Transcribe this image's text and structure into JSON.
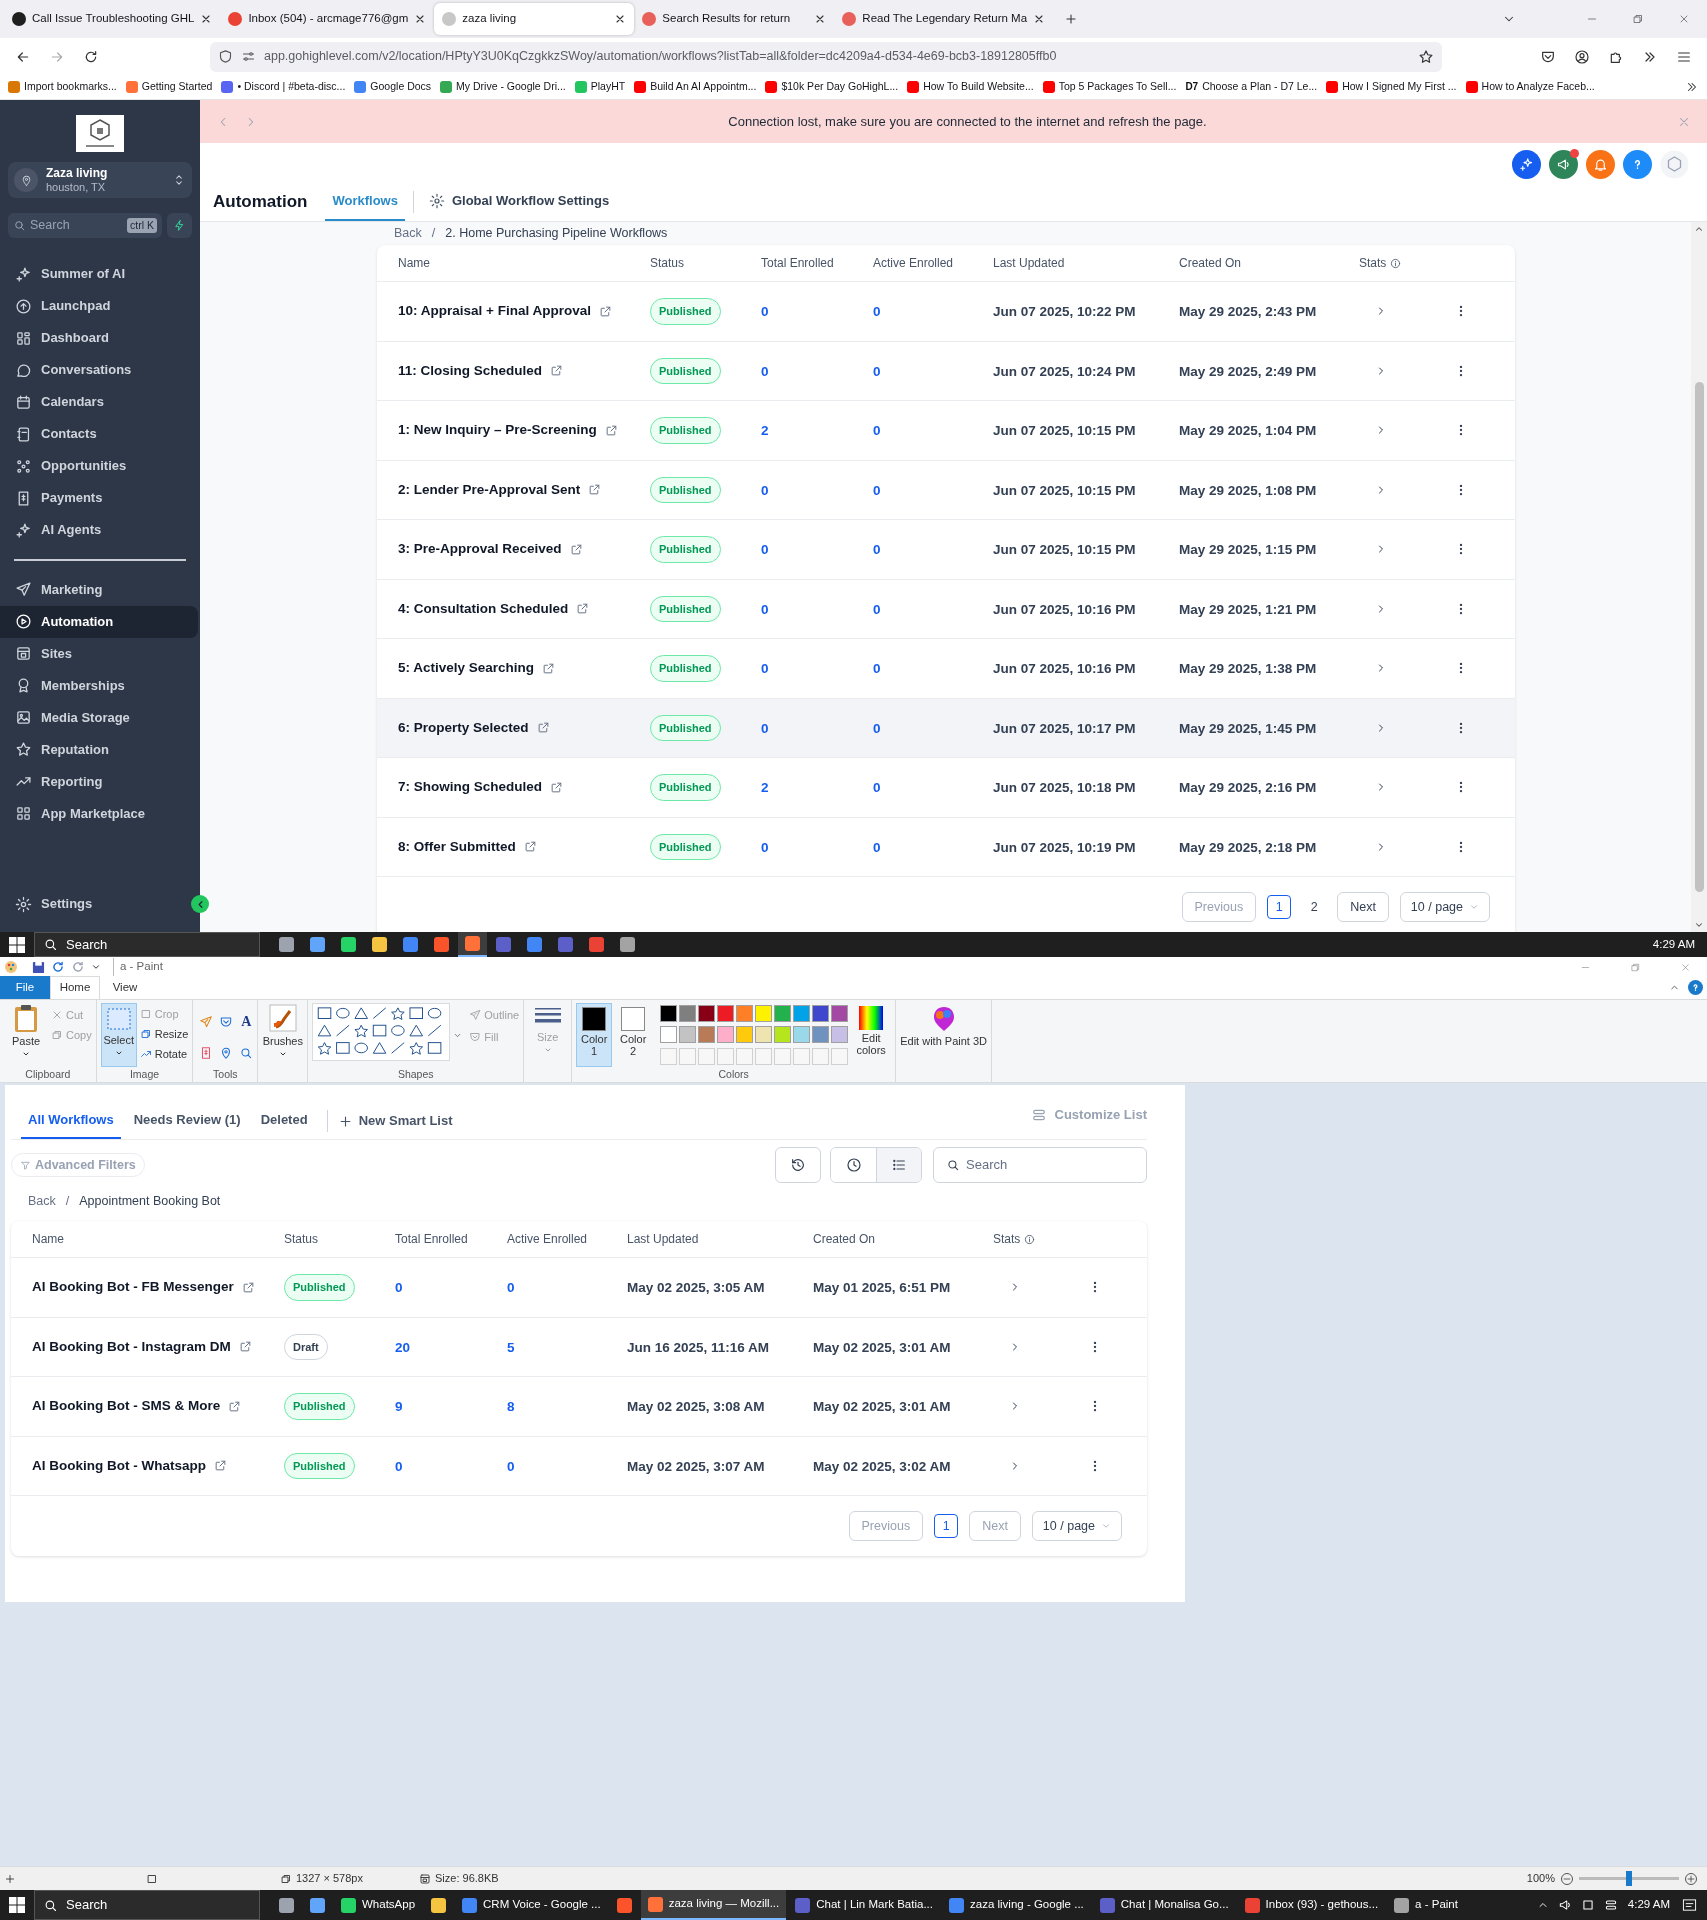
{
  "browser": {
    "tabs": [
      {
        "title": "Call Issue Troubleshooting GHL",
        "color": "#1f1f1f",
        "selected": false
      },
      {
        "title": "Inbox (504) - arcmage776@gm",
        "color": "#ea4335",
        "selected": false
      },
      {
        "title": "zaza living",
        "color": "#c8c8c8",
        "selected": true
      },
      {
        "title": "Search Results for return",
        "color": "#e8605a",
        "selected": false
      },
      {
        "title": "Read The Legendary Return Ma",
        "color": "#e8605a",
        "selected": false
      }
    ],
    "url": "app.gohighlevel.com/v2/location/HPtyY3U0KqCzgkkzSWoy/automation/workflows?listTab=all&folder=dc4209a4-d534-4e69-bcb3-18912805ffb0",
    "bookmarks": [
      {
        "label": "Import bookmarks...",
        "color": "#d97706"
      },
      {
        "label": "Getting Started",
        "color": "#ff7139"
      },
      {
        "label": "• Discord | #beta-disc...",
        "color": "#5865f2"
      },
      {
        "label": "Google Docs",
        "color": "#4285f4"
      },
      {
        "label": "My Drive - Google Dri...",
        "color": "#34a853"
      },
      {
        "label": "PlayHT",
        "color": "#22c55e"
      },
      {
        "label": "Build An AI Appointm...",
        "color": "#ff0000"
      },
      {
        "label": "$10k Per Day GoHighL...",
        "color": "#ff0000"
      },
      {
        "label": "How To Build Website...",
        "color": "#ff0000"
      },
      {
        "label": "Top 5 Packages To Sell...",
        "color": "#ff0000"
      },
      {
        "label": "Choose a Plan - D7 Le...",
        "color": "#111111",
        "icon_text": "D7"
      },
      {
        "label": "How I Signed My First ...",
        "color": "#ff0000"
      },
      {
        "label": "How to Analyze Faceb...",
        "color": "#ff0000"
      }
    ]
  },
  "app": {
    "banner": {
      "text": "Connection lost, make sure you are connected to the internet and refresh the page."
    },
    "sidebar": {
      "account": {
        "name": "Zaza living",
        "location": "houston, TX"
      },
      "search": {
        "placeholder": "Search",
        "shortcut": "ctrl K"
      },
      "items": [
        {
          "label": "Summer of AI",
          "selected": false
        },
        {
          "label": "Launchpad",
          "selected": false
        },
        {
          "label": "Dashboard",
          "selected": false
        },
        {
          "label": "Conversations",
          "selected": false
        },
        {
          "label": "Calendars",
          "selected": false
        },
        {
          "label": "Contacts",
          "selected": false
        },
        {
          "label": "Opportunities",
          "selected": false
        },
        {
          "label": "Payments",
          "selected": false
        },
        {
          "label": "AI Agents",
          "selected": false
        }
      ],
      "items_secondary": [
        {
          "label": "Marketing",
          "selected": false
        },
        {
          "label": "Automation",
          "selected": true
        },
        {
          "label": "Sites",
          "selected": false
        },
        {
          "label": "Memberships",
          "selected": false
        },
        {
          "label": "Media Storage",
          "selected": false
        },
        {
          "label": "Reputation",
          "selected": false
        },
        {
          "label": "Reporting",
          "selected": false
        },
        {
          "label": "App Marketplace",
          "selected": false
        }
      ],
      "settings": {
        "label": "Settings",
        "selected": false
      }
    },
    "header": {
      "title": "Automation",
      "tabs": [
        {
          "label": "Workflows",
          "selected": true
        },
        {
          "label": "Global Workflow Settings",
          "selected": false
        }
      ],
      "notification_dot": true
    },
    "breadcrumb": {
      "back": "Back",
      "separator": "/",
      "current": "2. Home Purchasing Pipeline Workflows"
    },
    "table": {
      "columns": [
        "Name",
        "Status",
        "Total Enrolled",
        "Active Enrolled",
        "Last Updated",
        "Created On",
        "Stats"
      ],
      "rows": [
        {
          "name": "10: Appraisal + Final Approval",
          "status": {
            "label": "Published",
            "kind": "published"
          },
          "total_enrolled": "0",
          "active_enrolled": "0",
          "last_updated": "Jun 07 2025, 10:22 PM",
          "created_on": "May 29 2025, 2:43 PM",
          "hovered": false
        },
        {
          "name": "11: Closing Scheduled",
          "status": {
            "label": "Published",
            "kind": "published"
          },
          "total_enrolled": "0",
          "active_enrolled": "0",
          "last_updated": "Jun 07 2025, 10:24 PM",
          "created_on": "May 29 2025, 2:49 PM",
          "hovered": false
        },
        {
          "name": "1: New Inquiry – Pre-Screening",
          "status": {
            "label": "Published",
            "kind": "published"
          },
          "total_enrolled": "2",
          "active_enrolled": "0",
          "last_updated": "Jun 07 2025, 10:15 PM",
          "created_on": "May 29 2025, 1:04 PM",
          "hovered": false
        },
        {
          "name": "2: Lender Pre-Approval Sent",
          "status": {
            "label": "Published",
            "kind": "published"
          },
          "total_enrolled": "0",
          "active_enrolled": "0",
          "last_updated": "Jun 07 2025, 10:15 PM",
          "created_on": "May 29 2025, 1:08 PM",
          "hovered": false
        },
        {
          "name": "3: Pre-Approval Received",
          "status": {
            "label": "Published",
            "kind": "published"
          },
          "total_enrolled": "0",
          "active_enrolled": "0",
          "last_updated": "Jun 07 2025, 10:15 PM",
          "created_on": "May 29 2025, 1:15 PM",
          "hovered": false
        },
        {
          "name": "4: Consultation Scheduled",
          "status": {
            "label": "Published",
            "kind": "published"
          },
          "total_enrolled": "0",
          "active_enrolled": "0",
          "last_updated": "Jun 07 2025, 10:16 PM",
          "created_on": "May 29 2025, 1:21 PM",
          "hovered": false
        },
        {
          "name": "5: Actively Searching",
          "status": {
            "label": "Published",
            "kind": "published"
          },
          "total_enrolled": "0",
          "active_enrolled": "0",
          "last_updated": "Jun 07 2025, 10:16 PM",
          "created_on": "May 29 2025, 1:38 PM",
          "hovered": false
        },
        {
          "name": "6: Property Selected",
          "status": {
            "label": "Published",
            "kind": "published"
          },
          "total_enrolled": "0",
          "active_enrolled": "0",
          "last_updated": "Jun 07 2025, 10:17 PM",
          "created_on": "May 29 2025, 1:45 PM",
          "hovered": true
        },
        {
          "name": "7: Showing Scheduled",
          "status": {
            "label": "Published",
            "kind": "published"
          },
          "total_enrolled": "2",
          "active_enrolled": "0",
          "last_updated": "Jun 07 2025, 10:18 PM",
          "created_on": "May 29 2025, 2:16 PM",
          "hovered": false
        },
        {
          "name": "8: Offer Submitted",
          "status": {
            "label": "Published",
            "kind": "published"
          },
          "total_enrolled": "0",
          "active_enrolled": "0",
          "last_updated": "Jun 07 2025, 10:19 PM",
          "created_on": "May 29 2025, 2:18 PM",
          "hovered": false
        }
      ]
    },
    "pagination": {
      "previous": {
        "label": "Previous",
        "disabled": true
      },
      "pages": [
        {
          "label": "1",
          "selected": true
        },
        {
          "label": "2",
          "selected": false
        }
      ],
      "next": {
        "label": "Next",
        "disabled": false
      },
      "page_size": "10 / page"
    }
  },
  "taskbar_top": {
    "search_placeholder": "Search",
    "time": "4:29 AM",
    "apps": [
      {
        "color": "#9ca3af",
        "selected": false
      },
      {
        "color": "#60a5fa",
        "selected": false
      },
      {
        "color": "#25d366",
        "selected": false
      },
      {
        "color": "#f5c542",
        "selected": false
      },
      {
        "color": "#4285f4",
        "selected": false
      },
      {
        "color": "#fb542b",
        "selected": false
      },
      {
        "color": "#ff7139",
        "selected": true
      },
      {
        "color": "#5b5fc7",
        "selected": false
      },
      {
        "color": "#4285f4",
        "selected": false
      },
      {
        "color": "#5b5fc7",
        "selected": false
      },
      {
        "color": "#ea4335",
        "selected": false
      },
      {
        "color": "#a3a3a3",
        "selected": false
      }
    ]
  },
  "paint": {
    "title": "a - Paint",
    "menu_tabs": [
      {
        "label": "File",
        "kind": "file",
        "selected": false
      },
      {
        "label": "Home",
        "kind": "tab",
        "selected": true
      },
      {
        "label": "View",
        "kind": "tab",
        "selected": false
      }
    ],
    "ribbon": {
      "clipboard": {
        "label": "Clipboard",
        "paste": "Paste",
        "cut": {
          "label": "Cut",
          "disabled": true
        },
        "copy": {
          "label": "Copy",
          "disabled": true
        }
      },
      "image": {
        "label": "Image",
        "select": {
          "label": "Select",
          "selected": true
        },
        "crop": {
          "label": "Crop",
          "disabled": true
        },
        "resize": "Resize",
        "rotate": "Rotate"
      },
      "tools": {
        "label": "Tools",
        "text_tool": "A"
      },
      "brushes": "Brushes",
      "shapes": {
        "label": "Shapes",
        "outline": {
          "label": "Outline",
          "disabled": true
        },
        "fill": {
          "label": "Fill",
          "disabled": true
        }
      },
      "size": {
        "label": "Size",
        "disabled": true
      },
      "colors": {
        "label": "Colors",
        "color1": {
          "label": "Color 1",
          "color": "#000000",
          "selected": true
        },
        "color2": {
          "label": "Color 2",
          "color": "#ffffff",
          "selected": false
        },
        "palette": [
          {
            "color": "#000000"
          },
          {
            "color": "#7f7f7f"
          },
          {
            "color": "#880015"
          },
          {
            "color": "#ed1c24"
          },
          {
            "color": "#ff7f27"
          },
          {
            "color": "#fff200"
          },
          {
            "color": "#22b14c"
          },
          {
            "color": "#00a2e8"
          },
          {
            "color": "#3f48cc"
          },
          {
            "color": "#a349a4"
          },
          {
            "color": "#ffffff"
          },
          {
            "color": "#c3c3c3"
          },
          {
            "color": "#b97a57"
          },
          {
            "color": "#ffaec9"
          },
          {
            "color": "#ffc90e"
          },
          {
            "color": "#efe4b0"
          },
          {
            "color": "#b5e61d"
          },
          {
            "color": "#99d9ea"
          },
          {
            "color": "#7092be"
          },
          {
            "color": "#c8bfe7"
          }
        ],
        "edit_colors": "Edit colors"
      },
      "paint3d": "Edit with Paint 3D"
    },
    "image": {
      "tabs": [
        {
          "label": "All Workflows",
          "selected": true
        },
        {
          "label": "Needs Review (1)",
          "selected": false
        },
        {
          "label": "Deleted",
          "selected": false
        }
      ],
      "new_list": "New Smart List",
      "customize": {
        "label": "Customize List",
        "disabled": true
      },
      "filters": "Advanced Filters",
      "view_toggle": [
        {
          "selected": false
        },
        {
          "selected": true
        }
      ],
      "search_placeholder": "Search",
      "breadcrumb": {
        "back": "Back",
        "separator": "/",
        "current": "Appointment Booking Bot"
      },
      "table": {
        "columns": [
          "Name",
          "Status",
          "Total Enrolled",
          "Active Enrolled",
          "Last Updated",
          "Created On",
          "Stats"
        ],
        "rows": [
          {
            "name": "AI Booking Bot - FB Messenger",
            "status": {
              "label": "Published",
              "kind": "published"
            },
            "total_enrolled": "0",
            "active_enrolled": "0",
            "last_updated": "May 02 2025, 3:05 AM",
            "created_on": "May 01 2025, 6:51 PM",
            "hovered": false
          },
          {
            "name": "AI Booking Bot - Instagram DM",
            "status": {
              "label": "Draft",
              "kind": "draft"
            },
            "total_enrolled": "20",
            "active_enrolled": "5",
            "last_updated": "Jun 16 2025, 11:16 AM",
            "created_on": "May 02 2025, 3:01 AM",
            "hovered": false
          },
          {
            "name": "AI Booking Bot - SMS & More",
            "status": {
              "label": "Published",
              "kind": "published"
            },
            "total_enrolled": "9",
            "active_enrolled": "8",
            "last_updated": "May 02 2025, 3:08 AM",
            "created_on": "May 02 2025, 3:01 AM",
            "hovered": false
          },
          {
            "name": "AI Booking Bot - Whatsapp",
            "status": {
              "label": "Published",
              "kind": "published"
            },
            "total_enrolled": "0",
            "active_enrolled": "0",
            "last_updated": "May 02 2025, 3:07 AM",
            "created_on": "May 02 2025, 3:02 AM",
            "hovered": false
          }
        ]
      },
      "pagination": {
        "previous": {
          "label": "Previous",
          "disabled": true
        },
        "pages": [
          {
            "label": "1",
            "selected": true
          }
        ],
        "next": {
          "label": "Next",
          "disabled": true
        },
        "page_size": "10 / page"
      }
    },
    "status_bar": {
      "dimensions": "1327 × 578px",
      "size": "Size: 96.8KB",
      "zoom": "100%",
      "zoom_slider": {
        "level": 0.5
      }
    }
  },
  "taskbar_bottom": {
    "search_placeholder": "Search",
    "time": "4:29 AM",
    "apps": [
      {
        "color": "#9ca3af",
        "selected": false
      },
      {
        "color": "#60a5fa",
        "selected": false
      },
      {
        "label": "WhatsApp",
        "color": "#25d366",
        "selected": false
      },
      {
        "color": "#f5c542",
        "selected": false
      },
      {
        "label": "CRM Voice - Google ...",
        "color": "#4285f4",
        "selected": false
      },
      {
        "color": "#fb542b",
        "selected": false
      },
      {
        "label": "zaza living — Mozill...",
        "color": "#ff7139",
        "selected": true
      },
      {
        "label": "Chat | Lin Mark Batia...",
        "color": "#5b5fc7",
        "selected": false
      },
      {
        "label": "zaza living - Google ...",
        "color": "#4285f4",
        "selected": false
      },
      {
        "label": "Chat | Monalisa Go...",
        "color": "#5b5fc7",
        "selected": false
      },
      {
        "label": "Inbox (93) - gethous...",
        "color": "#ea4335",
        "selected": false
      },
      {
        "label": "a - Paint",
        "color": "#a3a3a3",
        "selected": false
      }
    ]
  }
}
